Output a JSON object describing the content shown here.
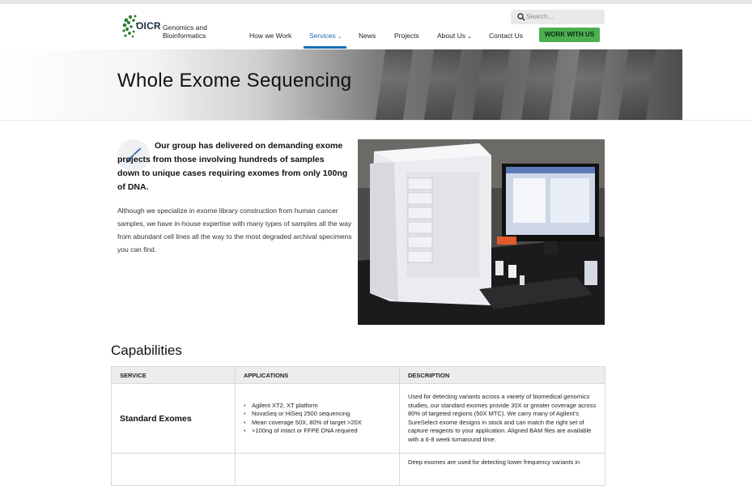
{
  "header": {
    "logo_org": "OICR",
    "logo_tagline": "Genomics and Bioinformatics",
    "search_placeholder": "Search...",
    "cta_label": "WORK WITH US"
  },
  "nav": [
    {
      "label": "How we Work",
      "active": false
    },
    {
      "label": "Services",
      "active": true,
      "dropdown": true
    },
    {
      "label": "News",
      "active": false
    },
    {
      "label": "Projects",
      "active": false
    },
    {
      "label": "About Us",
      "active": false,
      "dropdown": true
    },
    {
      "label": "Contact Us",
      "active": false
    }
  ],
  "hero": {
    "title": "Whole Exome Sequencing"
  },
  "intro": {
    "lead": "Our group has delivered on demanding exome projects from those involving hundreds of samples down to unique cases requiring exomes from only 100ng of DNA.",
    "body": "Although we specialize in exome library construction from human cancer samples, we have in-house expertise with many types of samples all the way from abundant cell lines all the way to the most degraded archival specimens you can find."
  },
  "capabilities": {
    "heading": "Capabilities",
    "columns": [
      "SERVICE",
      "APPLICATIONS",
      "DESCRIPTION"
    ],
    "rows": [
      {
        "service": "Standard Exomes",
        "applications": [
          "Agilent XT2, XT platform",
          "NovaSeq or HiSeq 2500 sequencing",
          "Mean coverage 50X, 80% of target >20X",
          ">100ng of intact or FFPE DNA required"
        ],
        "description": "Used for detecting variants across a variety of biomedical genomics studies, our standard exomes provide 30X or greater coverage across 80% of targeted regions (50X MTC). We carry many of Agilent's SureSelect exome designs in stock and can match the right set of capture reagents to your application. Aligned BAM files are available with a 6-8 week turnaround time."
      },
      {
        "service": "",
        "applications": [],
        "description": "Deep exomes are used for detecting lower frequency variants in"
      }
    ]
  },
  "colors": {
    "accent": "#1c6fb8",
    "cta": "#4caf50",
    "table_header": "#ededed"
  }
}
